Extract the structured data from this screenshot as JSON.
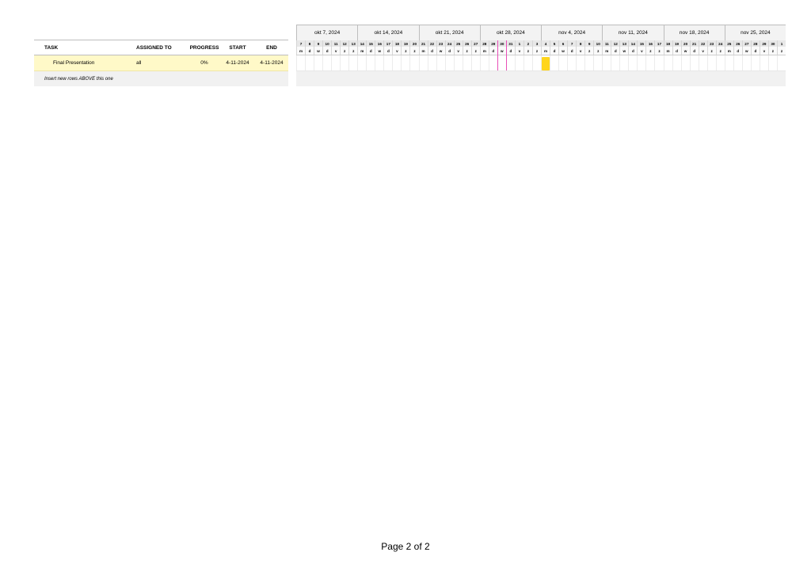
{
  "table": {
    "headers": {
      "task": "TASK",
      "assigned_to": "ASSIGNED TO",
      "progress": "PROGRESS",
      "start": "START",
      "end": "END"
    },
    "rows": [
      {
        "task": "Final Presentation",
        "assigned_to": "all",
        "progress": "0%",
        "start": "4-11-2024",
        "end": "4-11-2024"
      }
    ],
    "insert_note": "Insert new rows ABOVE this one"
  },
  "gantt": {
    "weeks": [
      "okt 7, 2024",
      "okt 14, 2024",
      "okt 21, 2024",
      "okt 28, 2024",
      "nov 4, 2024",
      "nov 11, 2024",
      "nov 18, 2024",
      "nov 25, 2024"
    ],
    "day_numbers": [
      "7",
      "8",
      "9",
      "10",
      "11",
      "12",
      "13",
      "14",
      "15",
      "16",
      "17",
      "18",
      "19",
      "20",
      "21",
      "22",
      "23",
      "24",
      "25",
      "26",
      "27",
      "28",
      "29",
      "30",
      "31",
      "1",
      "2",
      "3",
      "4",
      "5",
      "6",
      "7",
      "8",
      "9",
      "10",
      "11",
      "12",
      "13",
      "14",
      "15",
      "16",
      "17",
      "18",
      "19",
      "20",
      "21",
      "22",
      "23",
      "24",
      "25",
      "26",
      "27",
      "28",
      "29",
      "30",
      "1"
    ],
    "day_letters": [
      "m",
      "d",
      "w",
      "d",
      "v",
      "z",
      "z"
    ],
    "task_bar": {
      "task": "Final Presentation",
      "start_day_index": 28,
      "duration_days": 1
    },
    "today_day_index": 23,
    "colors": {
      "bar": "#ffd51c",
      "today_marker": "#e84fb8",
      "task_row": "#fff9c8"
    }
  },
  "footer": {
    "page_label": "Page 2 of 2"
  }
}
